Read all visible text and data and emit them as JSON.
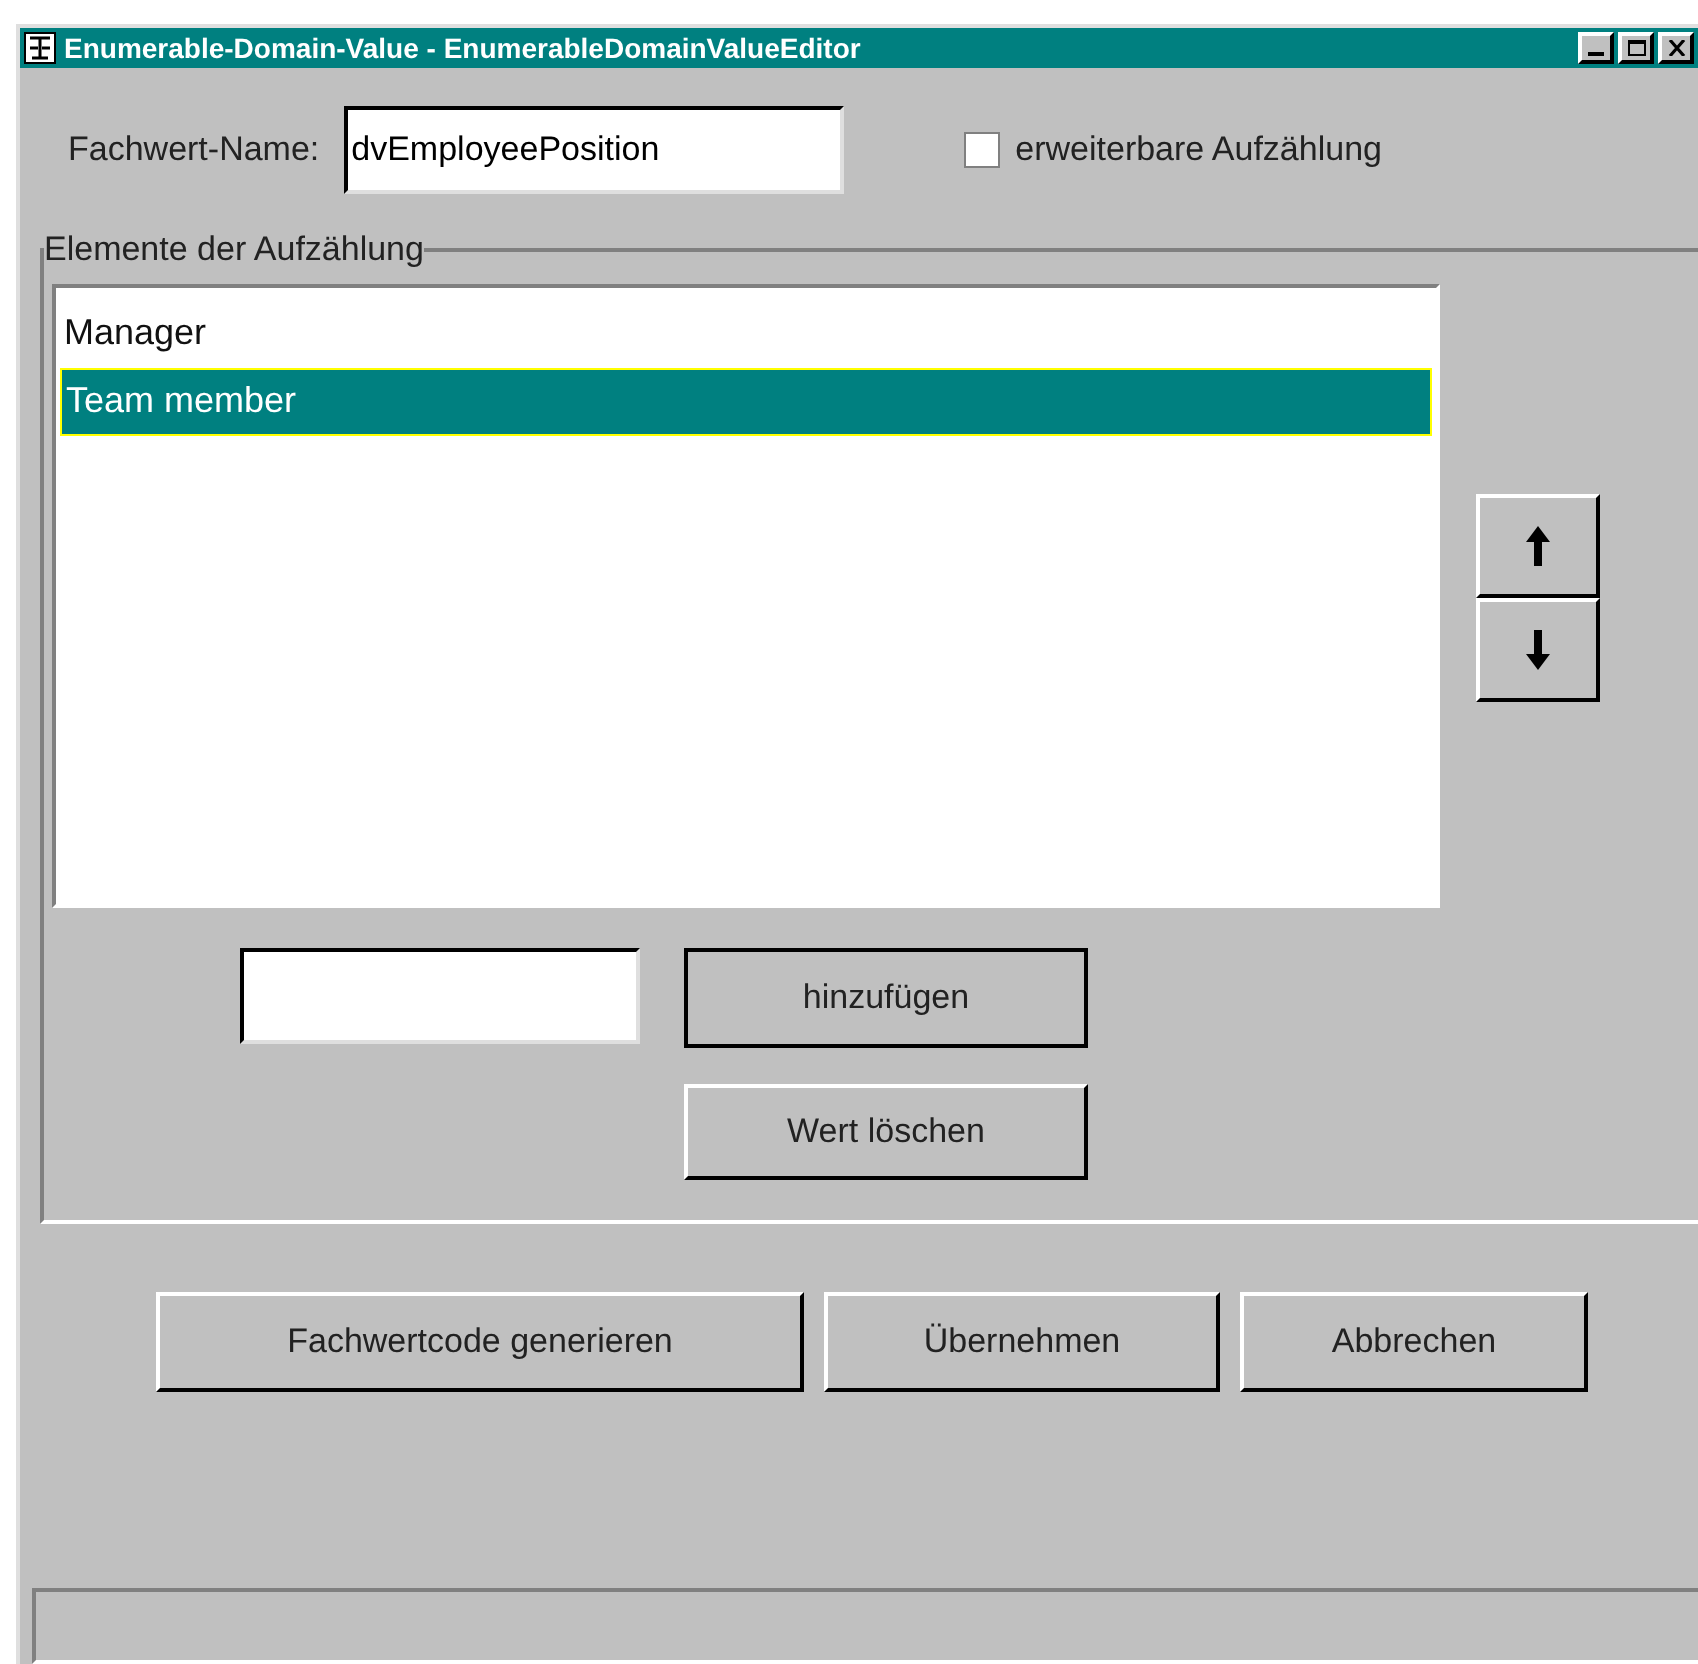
{
  "window": {
    "title": "Enumerable-Domain-Value - EnumerableDomainValueEditor"
  },
  "name_field": {
    "label": "Fachwert-Name:",
    "value": "dvEmployeePosition"
  },
  "extensible_checkbox": {
    "label": "erweiterbare Aufzählung",
    "checked": false
  },
  "elements_group": {
    "title": "Elemente der Aufzählung",
    "items": [
      {
        "label": "Manager",
        "selected": false
      },
      {
        "label": "Team member",
        "selected": true
      }
    ],
    "add_button": {
      "label": "hinzufügen"
    },
    "delete_button": {
      "label": "Wert löschen"
    }
  },
  "buttons": [
    {
      "label": "Fachwertcode generieren"
    },
    {
      "label": "Übernehmen"
    },
    {
      "label": "Abbrechen"
    }
  ]
}
